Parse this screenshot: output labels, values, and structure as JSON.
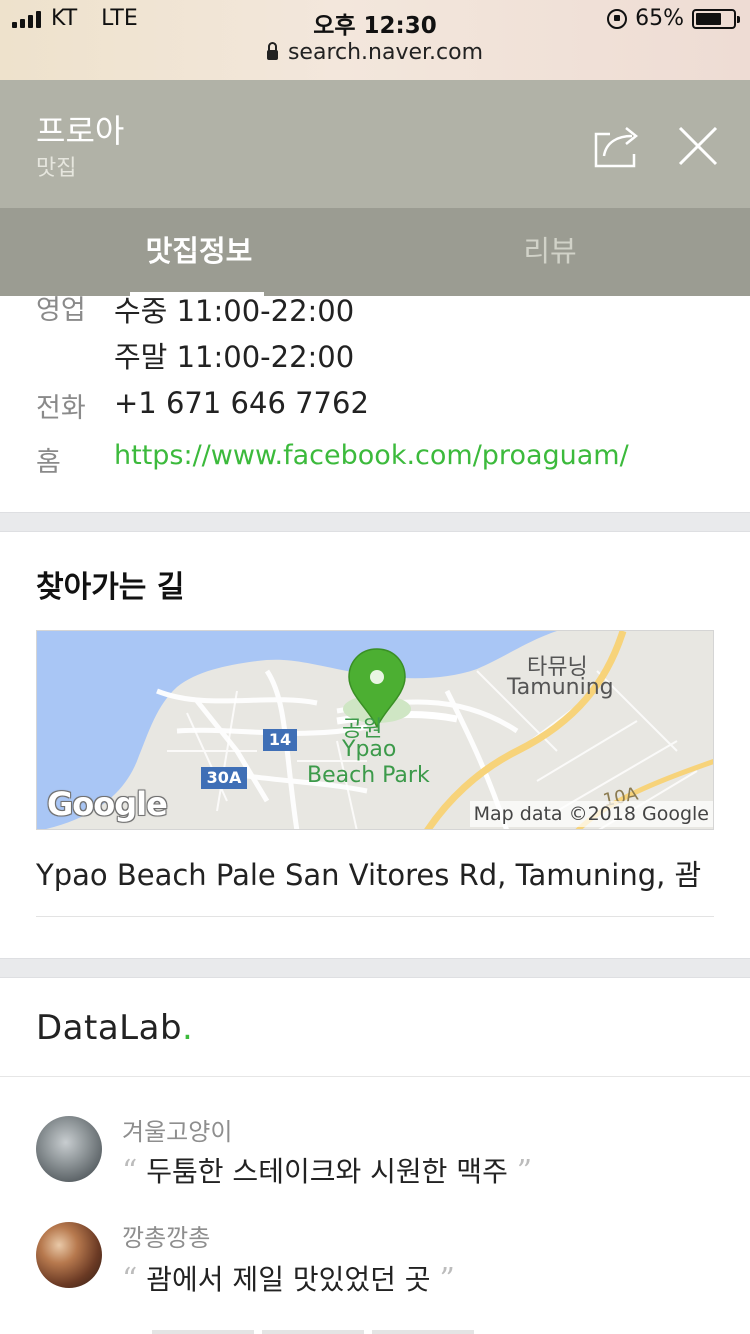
{
  "status_bar": {
    "carrier": "KT",
    "network": "LTE",
    "time": "오후 12:30",
    "url": "search.naver.com",
    "battery": "65%",
    "battery_level": 0.65
  },
  "header": {
    "title": "프로아",
    "subtitle": "맛집",
    "share_icon": "share-icon",
    "close_icon": "close-icon"
  },
  "tabs": [
    {
      "label": "맛집정보",
      "active": true
    },
    {
      "label": "리뷰",
      "active": false
    }
  ],
  "info": {
    "hours_label": "영업",
    "hours": [
      "수중 11:00-22:00",
      "주말 11:00-22:00"
    ],
    "phone_label": "전화",
    "phone": "+1 671 646 7762",
    "home_label": "홈",
    "home_url": "https://www.facebook.com/proaguam/"
  },
  "directions": {
    "heading": "찾아가는 길",
    "map": {
      "marker_label_ko": "공원",
      "marker_label_en1": "Ypao",
      "marker_label_en2": "Beach Park",
      "area_ko": "타뮤닝",
      "area_en": "Tamuning",
      "route_14": "14",
      "route_30a": "30A",
      "route_10a": "10A",
      "google_logo": "Google",
      "attribution": "Map data ©2018 Google",
      "colors": {
        "water": "#a9c6f5",
        "land": "#e8e7e2",
        "road": "#f7d37a",
        "marker": "#4caf32"
      }
    },
    "address": "Ypao Beach Pale San Vitores Rd, Tamuning, 괌"
  },
  "datalab": {
    "brand": "DataLab",
    "brand_dot": ".",
    "accent": "#3cba3c",
    "reviews": [
      {
        "user": "겨울고양이",
        "text": "두툼한 스테이크와 시원한 맥주"
      },
      {
        "user": "깡총깡총",
        "text": "괌에서 제일 맛있었던 곳"
      }
    ],
    "open_quote": "“",
    "close_quote": "”"
  }
}
